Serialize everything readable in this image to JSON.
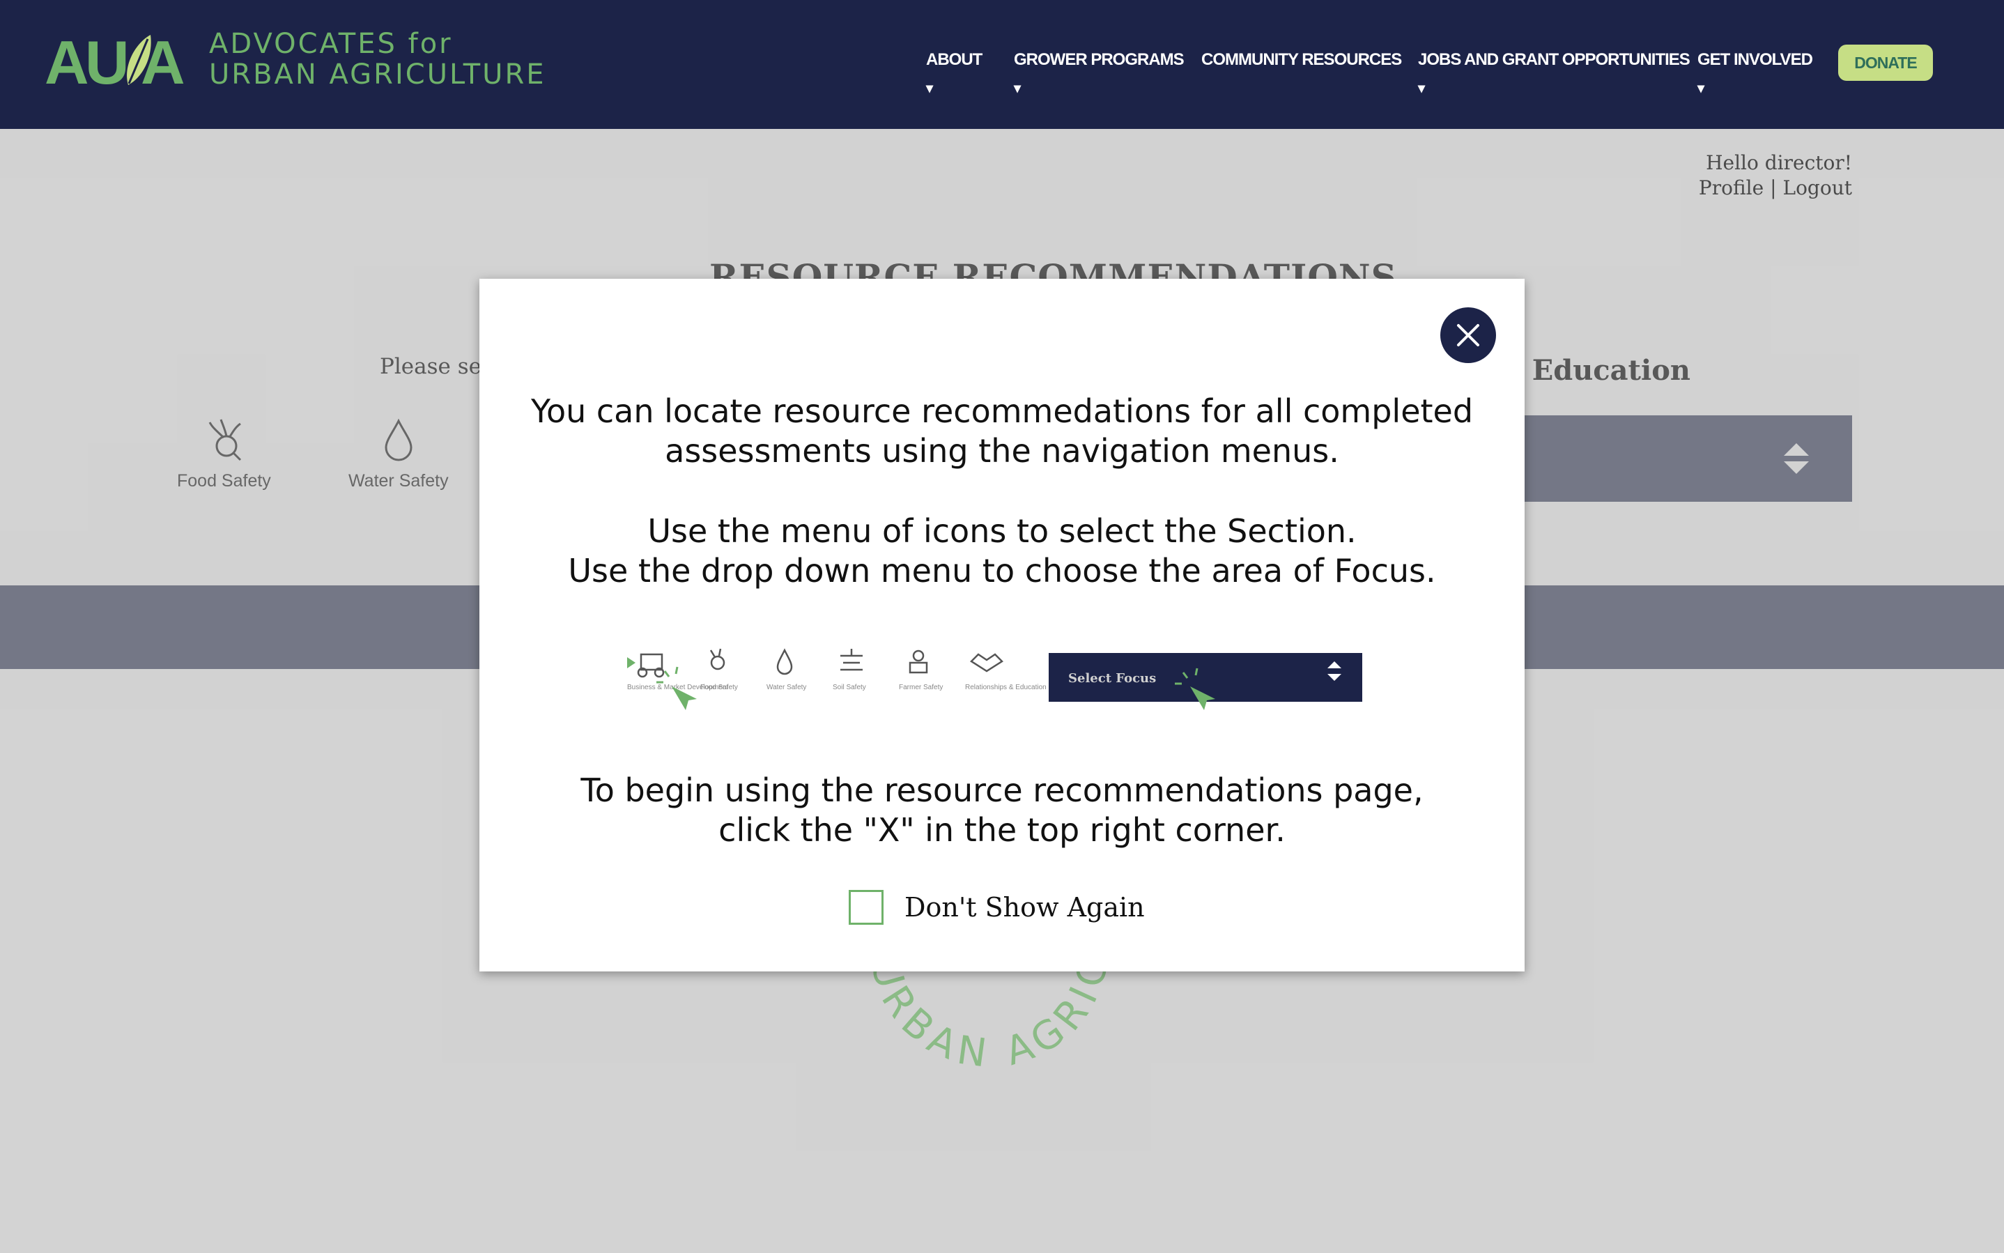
{
  "brand": {
    "mark": "AUA",
    "line1": "ADVOCATES for",
    "line2": "URBAN AGRICULTURE",
    "green": "#6fb26a",
    "navy": "#1c2348"
  },
  "nav": {
    "items": [
      {
        "label": "ABOUT",
        "caret": "▾"
      },
      {
        "label": "GROWER PROGRAMS",
        "caret": "▾"
      },
      {
        "label": "COMMUNITY RESOURCES",
        "caret": ""
      },
      {
        "label": "JOBS AND GRANT OPPORTUNITIES",
        "caret": "▾"
      },
      {
        "label": "GET INVOLVED",
        "caret": "▾"
      }
    ],
    "donate": "DONATE"
  },
  "user": {
    "greeting": "Hello director!",
    "profile": "Profile",
    "separator": "|",
    "logout": "Logout"
  },
  "page": {
    "heading": "RESOURCE RECOMMENDATIONS",
    "please_select": "Please sele",
    "section_title": "hips & Education",
    "section_icons": [
      "Food Safety",
      "Water Safety"
    ],
    "bg_circle_text": "URBAN AGRICULTURE"
  },
  "modal": {
    "line1a": "You can locate resource recommedations for all completed",
    "line1b": "assessments using the navigation menus.",
    "line2a": "Use the menu of icons to select the Section.",
    "line2b": "Use the drop down menu to choose the area of Focus.",
    "line3a": "To begin using the resource recommendations page,",
    "line3b": "click the \"X\" in the top right corner.",
    "dont_show": "Don't Show Again",
    "close_icon": "close-icon",
    "example": {
      "icon_labels": [
        "Business & Market Development",
        "Food Safety",
        "Water Safety",
        "Soil Safety",
        "Farmer Safety",
        "Relationships & Education"
      ],
      "select_label": "Select Focus"
    }
  }
}
